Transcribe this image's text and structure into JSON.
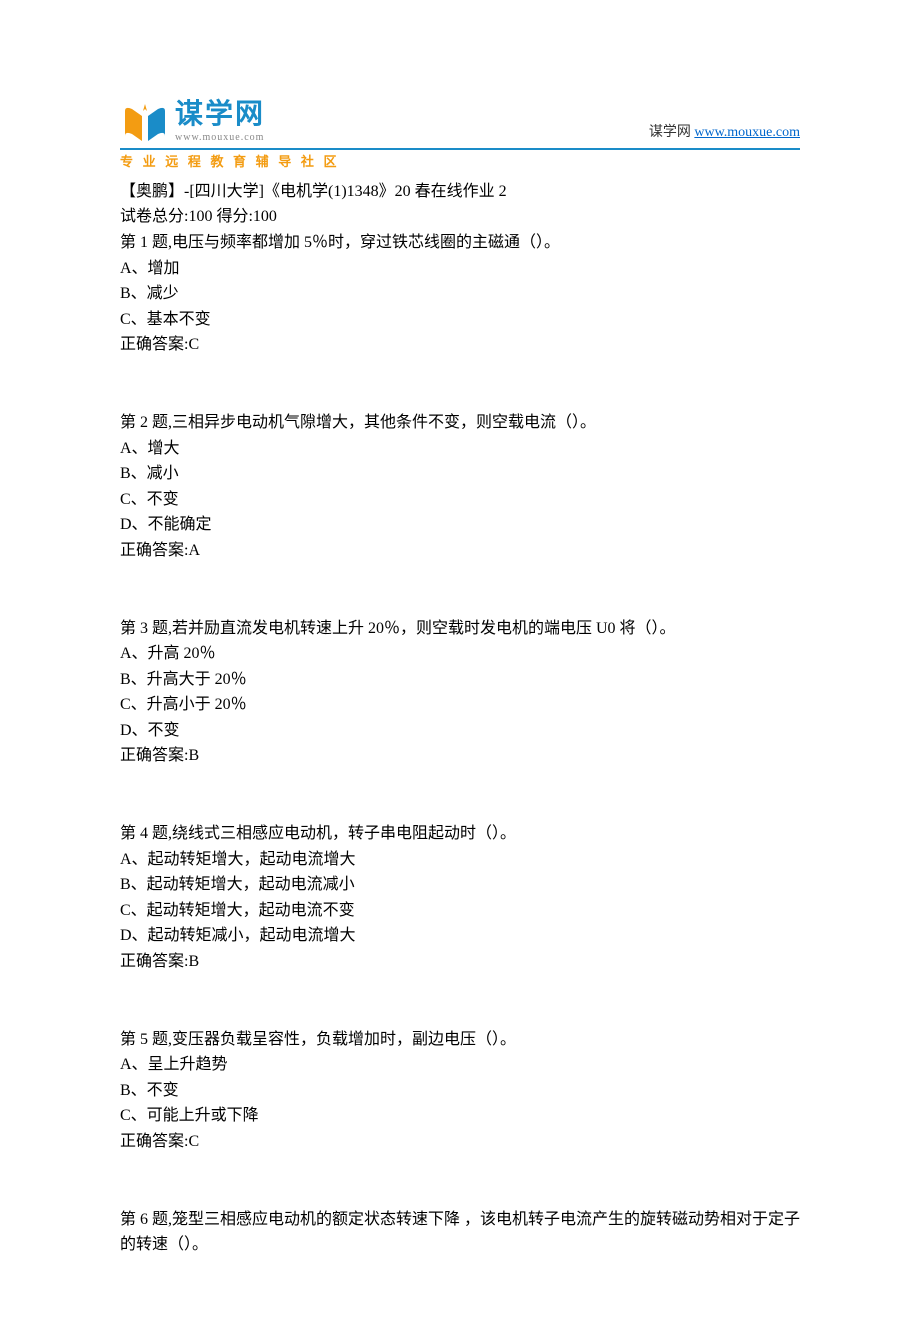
{
  "header": {
    "logo_main": "谋学网",
    "logo_domain": "www.mouxue.com",
    "logo_tagline": "专 业 远 程 教 育 辅 导 社 区",
    "right_label": "谋学网 ",
    "right_link": "www.mouxue.com"
  },
  "doc": {
    "title": "【奥鹏】-[四川大学]《电机学(1)1348》20 春在线作业 2",
    "score_line": "试卷总分:100    得分:100"
  },
  "questions": [
    {
      "prompt": "第 1 题,电压与频率都增加 5％时，穿过铁芯线圈的主磁通（）。",
      "options": [
        "A、增加",
        "B、减少",
        "C、基本不变"
      ],
      "answer": "正确答案:C"
    },
    {
      "prompt": "第 2 题,三相异步电动机气隙增大，其他条件不变，则空载电流（）。",
      "options": [
        "A、增大",
        "B、减小",
        "C、不变",
        "D、不能确定"
      ],
      "answer": "正确答案:A"
    },
    {
      "prompt": "第 3 题,若并励直流发电机转速上升 20％，则空载时发电机的端电压 U0 将（）。",
      "options": [
        "A、升高 20％",
        "B、升高大于 20％",
        "C、升高小于 20％",
        "D、不变"
      ],
      "answer": "正确答案:B"
    },
    {
      "prompt": "第 4 题,绕线式三相感应电动机，转子串电阻起动时（）。",
      "options": [
        "A、起动转矩增大，起动电流增大",
        "B、起动转矩增大，起动电流减小",
        "C、起动转矩增大，起动电流不变",
        "D、起动转矩减小，起动电流增大"
      ],
      "answer": "正确答案:B"
    },
    {
      "prompt": "第 5 题,变压器负载呈容性，负载增加时，副边电压（）。",
      "options": [
        "A、呈上升趋势",
        "B、不变",
        "C、可能上升或下降"
      ],
      "answer": "正确答案:C"
    },
    {
      "prompt": "第 6 题,笼型三相感应电动机的额定状态转速下降 ，该电机转子电流产生的旋转磁动势相对于定子的转速（）。",
      "options": [],
      "answer": ""
    }
  ]
}
